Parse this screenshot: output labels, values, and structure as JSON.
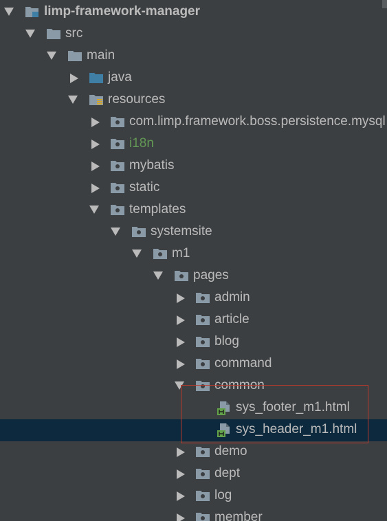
{
  "colors": {
    "background": "#3c3f41",
    "text": "#bbbbbb",
    "selection": "#0d293e",
    "i18n_text": "#629755",
    "highlight_border": "#c0392b",
    "folder_icon": "#8a9aa6",
    "source_folder_icon": "#3f7fa6",
    "html_badge": "#62a04a"
  },
  "tree": {
    "items": [
      {
        "label": "limp-framework-manager",
        "icon": "module-folder-icon",
        "expanded": true
      },
      {
        "label": "src",
        "icon": "folder-icon",
        "expanded": true
      },
      {
        "label": "main",
        "icon": "folder-icon",
        "expanded": true
      },
      {
        "label": "java",
        "icon": "source-folder-icon",
        "expanded": false
      },
      {
        "label": "resources",
        "icon": "resources-folder-icon",
        "expanded": true
      },
      {
        "label": "com.limp.framework.boss.persistence.mysql",
        "icon": "package-folder-icon",
        "expanded": false
      },
      {
        "label": "i18n",
        "icon": "package-folder-icon",
        "expanded": false
      },
      {
        "label": "mybatis",
        "icon": "package-folder-icon",
        "expanded": false
      },
      {
        "label": "static",
        "icon": "package-folder-icon",
        "expanded": false
      },
      {
        "label": "templates",
        "icon": "package-folder-icon",
        "expanded": true
      },
      {
        "label": "systemsite",
        "icon": "package-folder-icon",
        "expanded": true
      },
      {
        "label": "m1",
        "icon": "package-folder-icon",
        "expanded": true
      },
      {
        "label": "pages",
        "icon": "package-folder-icon",
        "expanded": true
      },
      {
        "label": "admin",
        "icon": "package-folder-icon",
        "expanded": false
      },
      {
        "label": "article",
        "icon": "package-folder-icon",
        "expanded": false
      },
      {
        "label": "blog",
        "icon": "package-folder-icon",
        "expanded": false
      },
      {
        "label": "command",
        "icon": "package-folder-icon",
        "expanded": false
      },
      {
        "label": "common",
        "icon": "package-folder-icon",
        "expanded": true
      },
      {
        "label": "sys_footer_m1.html",
        "icon": "html-file-icon"
      },
      {
        "label": "sys_header_m1.html",
        "icon": "html-file-icon",
        "selected": true
      },
      {
        "label": "demo",
        "icon": "package-folder-icon",
        "expanded": false
      },
      {
        "label": "dept",
        "icon": "package-folder-icon",
        "expanded": false
      },
      {
        "label": "log",
        "icon": "package-folder-icon",
        "expanded": false
      },
      {
        "label": "member",
        "icon": "package-folder-icon",
        "expanded": false
      }
    ]
  }
}
